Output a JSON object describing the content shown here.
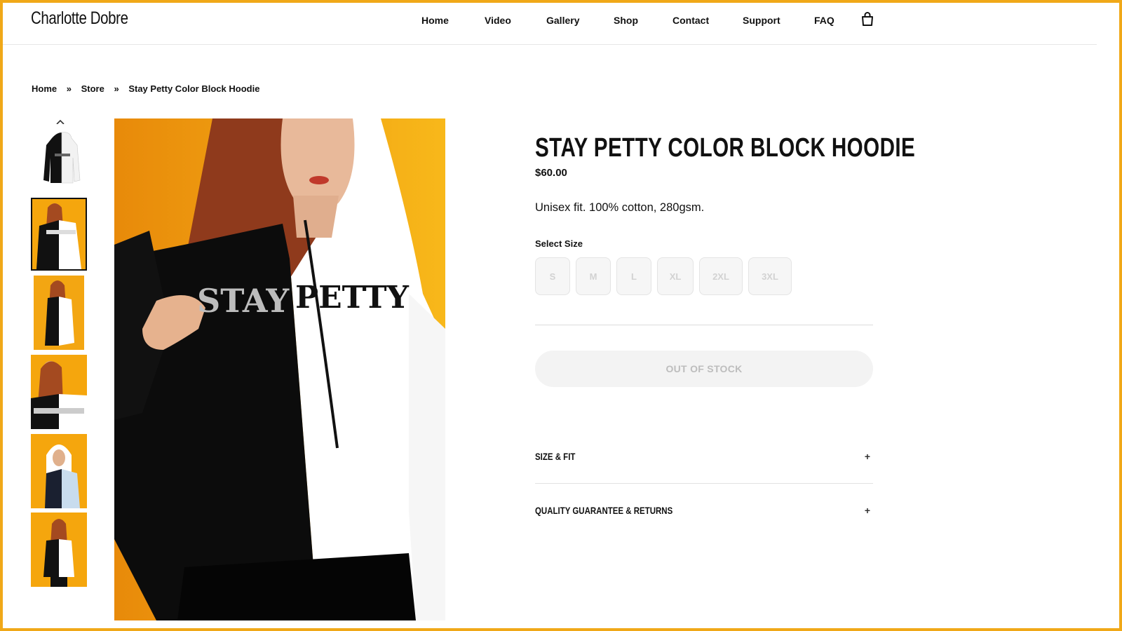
{
  "header": {
    "brand": "Charlotte Dobre",
    "nav": [
      "Home",
      "Video",
      "Gallery",
      "Shop",
      "Contact",
      "Support",
      "FAQ"
    ],
    "cart_icon": "shopping-bag-icon"
  },
  "breadcrumb": {
    "items": [
      "Home",
      "Store",
      "Stay Petty Color Block Hoodie"
    ],
    "separator": "»"
  },
  "gallery": {
    "up_icon": "chevron-up-icon",
    "thumbnail_count": 6,
    "active_index": 1,
    "main_image_text": [
      "STAY",
      "PETTY"
    ]
  },
  "product": {
    "title": "STAY PETTY COLOR BLOCK HOODIE",
    "price": "$60.00",
    "description": "Unisex fit. 100% cotton, 280gsm.",
    "size_label": "Select Size",
    "sizes": [
      "S",
      "M",
      "L",
      "XL",
      "2XL",
      "3XL"
    ],
    "button": "OUT OF STOCK"
  },
  "accordions": [
    {
      "label": "SIZE & FIT",
      "icon": "+"
    },
    {
      "label": "QUALITY GUARANTEE & RETURNS",
      "icon": "+"
    }
  ],
  "colors": {
    "frame": "#f0a818",
    "photo_background": "#f5a60d",
    "text": "#111111",
    "disabled": "#bdbdbd"
  }
}
